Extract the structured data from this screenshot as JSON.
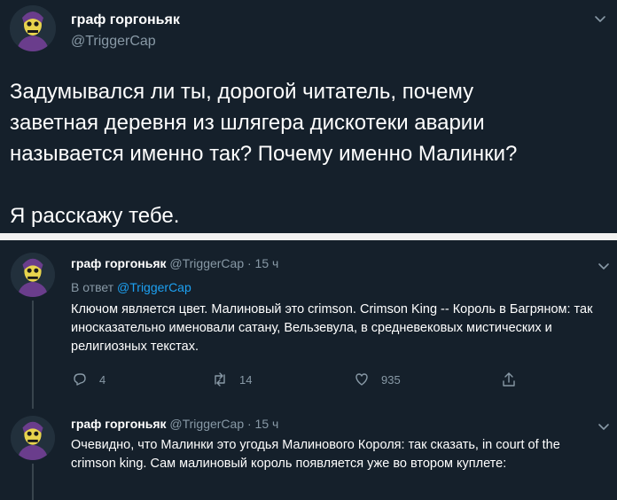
{
  "main": {
    "display_name": "граф горгоньяк",
    "handle": "@TriggerCap",
    "text": "Задумывался ли ты, дорогой читатель, почему\nзаветная деревня из шлягера дискотеки аварии\nназывается именно так? Почему именно Малинки?\n\nЯ расскажу тебе."
  },
  "replies": [
    {
      "display_name": "граф горгоньяк",
      "meta": "@TriggerCap · 15 ч",
      "replying_prefix": "В ответ",
      "replying_to": "@TriggerCap",
      "text": "Ключом является цвет. Малиновый это crimson. Crimson King -- Король в Багряном: так иносказательно именовали сатану, Вельзевула, в средневековых мистических и религиозных текстах.",
      "reply_count": "4",
      "retweet_count": "14",
      "like_count": "935"
    },
    {
      "display_name": "граф горгоньяк",
      "meta": "@TriggerCap · 15 ч",
      "text": "Очевидно, что Малинки это угодья Малинового Короля: так сказать, in court of the crimson king. Сам малиновый король появляется уже во втором куплете:"
    }
  ],
  "icons": {
    "avatar": "skeletor-avatar",
    "menu": "chevron-down-icon",
    "reply": "reply-icon",
    "retweet": "retweet-icon",
    "like": "heart-icon",
    "share": "share-icon"
  },
  "colors": {
    "background": "#15202b",
    "text": "#ffffff",
    "secondary": "#8899a6",
    "link": "#1da1f2",
    "divider": "#f2f2f2"
  }
}
